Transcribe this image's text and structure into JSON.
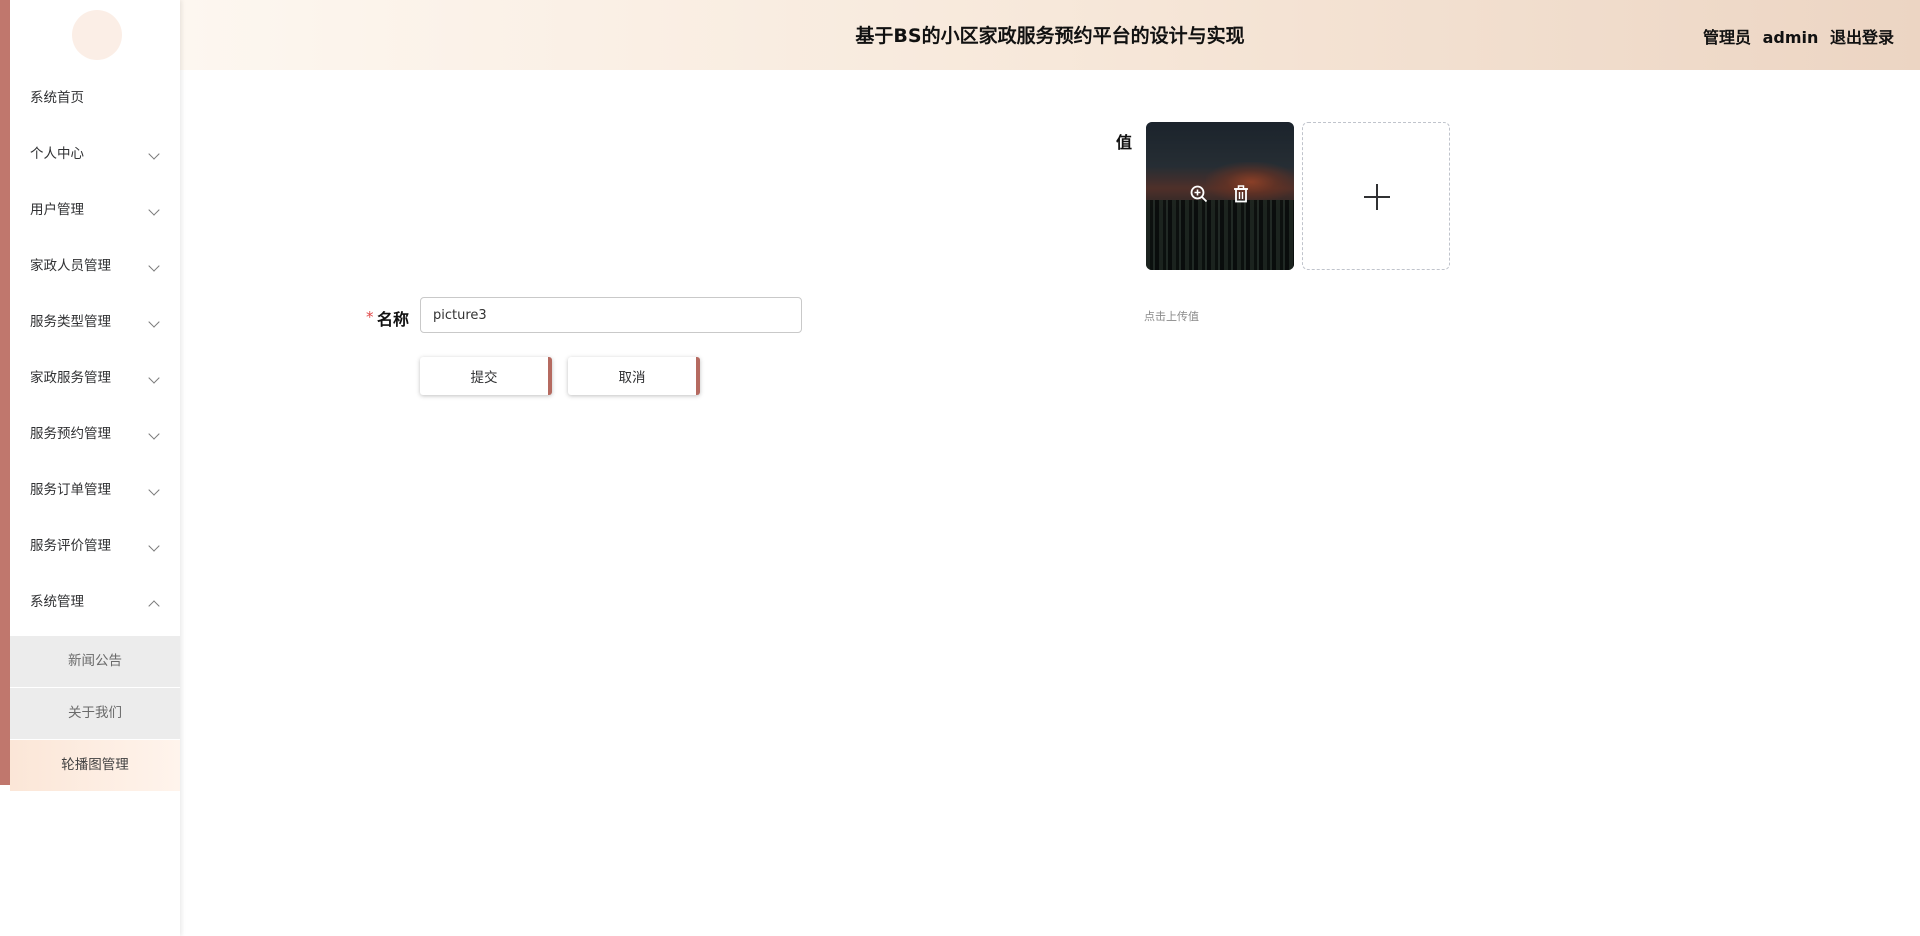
{
  "header": {
    "title": "基于BS的小区家政服务预约平台的设计与实现",
    "user_role": "管理员",
    "username": "admin",
    "logout_label": "退出登录"
  },
  "sidebar": {
    "items": [
      {
        "label": "系统首页",
        "expandable": false
      },
      {
        "label": "个人中心",
        "expandable": true
      },
      {
        "label": "用户管理",
        "expandable": true
      },
      {
        "label": "家政人员管理",
        "expandable": true
      },
      {
        "label": "服务类型管理",
        "expandable": true
      },
      {
        "label": "家政服务管理",
        "expandable": true
      },
      {
        "label": "服务预约管理",
        "expandable": true
      },
      {
        "label": "服务订单管理",
        "expandable": true
      },
      {
        "label": "服务评价管理",
        "expandable": true
      },
      {
        "label": "系统管理",
        "expandable": true,
        "expanded": true
      }
    ],
    "sub_items": [
      {
        "label": "新闻公告"
      },
      {
        "label": "关于我们"
      },
      {
        "label": "轮播图管理",
        "active": true
      }
    ]
  },
  "form": {
    "name_label": "名称",
    "name_value": "picture3",
    "value_label": "值",
    "upload_hint": "点击上传值",
    "submit_label": "提交",
    "cancel_label": "取消"
  },
  "icons": {
    "zoom": "zoom-in-icon",
    "delete": "delete-icon",
    "add": "plus-icon",
    "chevron": "chevron-icon"
  },
  "colors": {
    "accent": "#c0776d",
    "active_menu": "#fbe6d7",
    "required": "#e04848"
  }
}
